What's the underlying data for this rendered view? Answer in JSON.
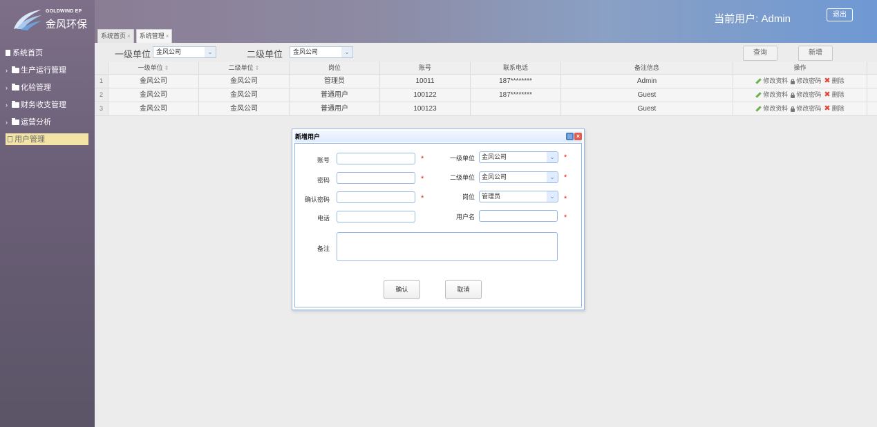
{
  "brand": {
    "en": "GOLDWIND EP",
    "cn": "金风环保"
  },
  "header": {
    "current_user": "当前用户: Admin",
    "logout": "退出"
  },
  "tabs": [
    {
      "label": "系统首页",
      "close": "×"
    },
    {
      "label": "系统管理",
      "close": "×"
    }
  ],
  "sidebar": {
    "items": [
      {
        "label": "系统首页"
      },
      {
        "label": "生产运行管理",
        "caret": "›"
      },
      {
        "label": "化验管理",
        "caret": "›"
      },
      {
        "label": "财务收支管理",
        "caret": "›"
      },
      {
        "label": "运营分析",
        "caret": "›"
      },
      {
        "label": "用户管理"
      }
    ]
  },
  "filter": {
    "level1_label": "一级单位",
    "level1_value": "金风公司",
    "level2_label": "二级单位",
    "level2_value": "金风公司",
    "query": "查询",
    "add": "新增"
  },
  "table": {
    "headers": [
      "一级单位",
      "二级单位",
      "岗位",
      "账号",
      "联系电话",
      "备注信息",
      "操作"
    ],
    "sort_mark": "⇕",
    "rows": [
      {
        "n": "1",
        "l1": "金风公司",
        "l2": "金风公司",
        "post": "管理员",
        "account": "10011",
        "phone": "187********",
        "note": "Admin"
      },
      {
        "n": "2",
        "l1": "金风公司",
        "l2": "金风公司",
        "post": "普通用户",
        "account": "100122",
        "phone": "187********",
        "note": "Guest"
      },
      {
        "n": "3",
        "l1": "金风公司",
        "l2": "金风公司",
        "post": "普通用户",
        "account": "100123",
        "phone": "",
        "note": "Guest"
      }
    ],
    "ops": {
      "edit": "修改资料",
      "password": "修改密码",
      "delete": "删除"
    }
  },
  "dialog": {
    "title": "新增用户",
    "account": "账号",
    "password": "密码",
    "confirm_password": "确认密码",
    "phone": "电话",
    "level1": "一级单位",
    "level1_value": "金风公司",
    "level2": "二级单位",
    "level2_value": "金风公司",
    "post": "岗位",
    "post_value": "管理员",
    "username": "用户名",
    "remark": "备注",
    "required": "*",
    "ok": "确认",
    "cancel": "取消"
  },
  "colors": {
    "accent": "#95b8e7",
    "active_nav": "#f3e4a6",
    "required": "#e02020"
  }
}
